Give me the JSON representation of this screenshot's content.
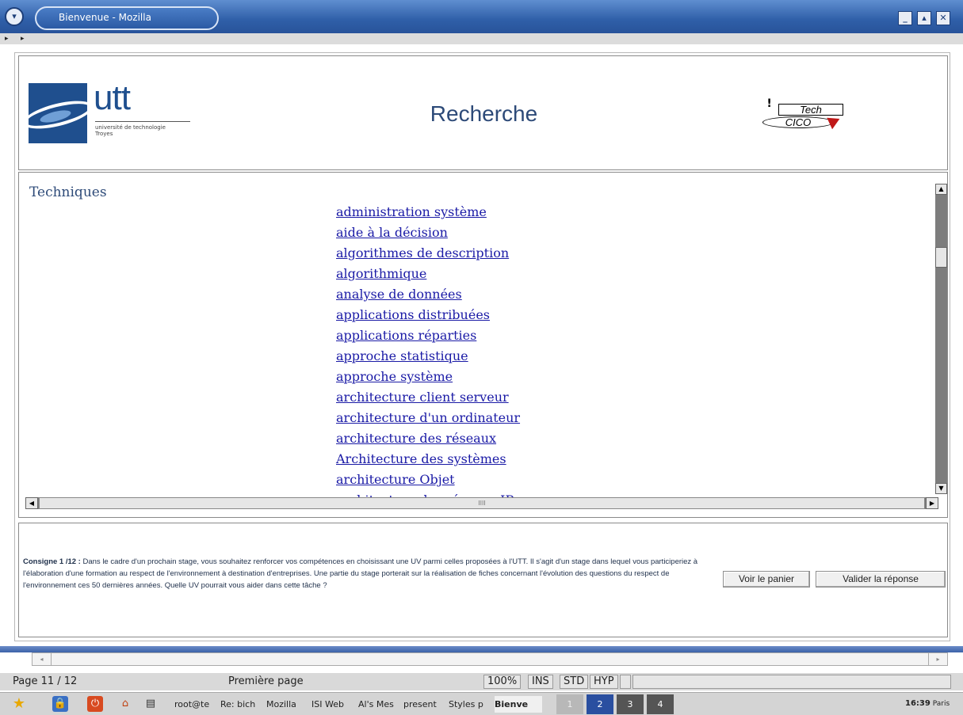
{
  "window": {
    "title": "Bienvenue - Mozilla",
    "menu_icon": "▾",
    "nav_left": "◂",
    "nav_right": "▸"
  },
  "header": {
    "heading": "Recherche",
    "utt_logo": {
      "word": "utt",
      "subtitle": "université de technologie",
      "city": "Troyes"
    },
    "tech_cico_logo": {
      "top": "Tech",
      "bottom": "CICO"
    }
  },
  "content": {
    "section_title": "Techniques",
    "links": [
      "administration système",
      "aide à la décision",
      "algorithmes de description",
      "algorithmique",
      "analyse de données",
      "applications distribuées",
      "applications réparties",
      "approche statistique",
      "approche système",
      "architecture client serveur",
      "architecture d'un ordinateur",
      "architecture des réseaux",
      "Architecture des systèmes",
      "architecture Objet",
      "architecture des réseaux IP"
    ],
    "hscroll_grip": "IIII"
  },
  "consigne": {
    "label": "Consigne 1 /12 :",
    "text": "Dans le cadre d'un prochain stage, vous souhaitez renforcer vos compétences en choisissant une UV parmi celles proposées à l'UTT. Il s'agit d'un stage dans lequel vous participeriez à l'élaboration d'une formation au respect de l'environnement à destination d'entreprises. Une partie du stage porterait sur la réalisation de fiches concernant l'évolution des questions du respect de l'environnement ces 50 dernières années. Quelle UV pourrait vous aider dans cette tâche ?",
    "cart_button": "Voir le panier",
    "validate_button": "Valider la réponse"
  },
  "statusbar": {
    "page": "Page 11 / 12",
    "page_style": "Première page",
    "zoom": "100%",
    "ins": "INS",
    "std": "STD",
    "hyp": "HYP"
  },
  "taskbar": {
    "tasks": [
      "root@te",
      "Re: bich",
      "Mozilla",
      "ISI Web",
      "Al's Mes",
      "present",
      "Styles p",
      "Bienve"
    ],
    "workspaces": [
      "1",
      "2",
      "3",
      "4"
    ],
    "clock_time": "16:39",
    "clock_city": "Paris"
  },
  "colors": {
    "title_bar": "#2f5fa8",
    "link": "#1a1aa6",
    "heading": "#2d4a78",
    "workspace_active": "#2a4fa0"
  }
}
